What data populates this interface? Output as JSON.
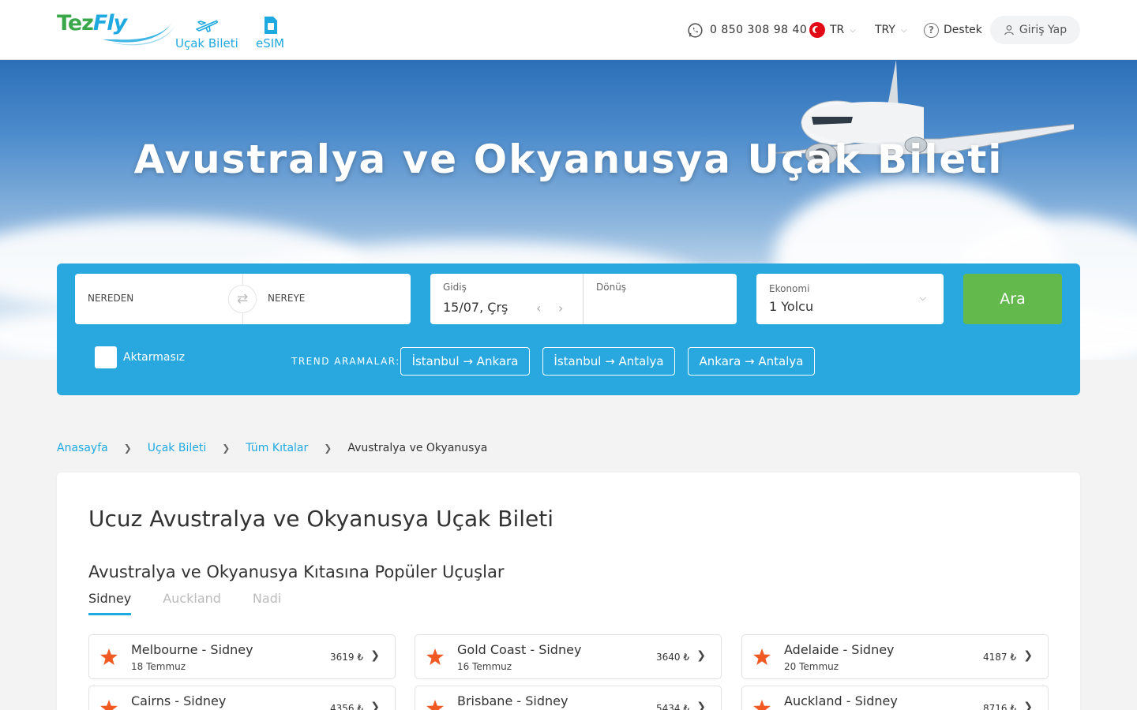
{
  "header": {
    "logo": {
      "part1": "Tez",
      "part2": "Fly"
    },
    "nav": [
      {
        "label": "Uçak Bileti",
        "icon": "plane-icon"
      },
      {
        "label": "eSIM",
        "icon": "sim-card-icon"
      }
    ],
    "phone": "0 850 308 98 40",
    "language": "TR",
    "currency": "TRY",
    "support": "Destek",
    "login": "Giriş Yap"
  },
  "hero": {
    "title": "Avustralya ve Okyanusya Uçak Bileti"
  },
  "search": {
    "from_label": "NEREDEN",
    "to_label": "NEREYE",
    "depart_label": "Gidiş",
    "depart_value": "15/07, Çrş",
    "return_label": "Dönüş",
    "return_value": "",
    "cabin_label": "Ekonomi",
    "passengers_value": "1 Yolcu",
    "search_button": "Ara",
    "direct_label": "Aktarmasız",
    "trend_label": "TREND ARAMALAR:",
    "trends": [
      "İstanbul → Ankara",
      "İstanbul → Antalya",
      "Ankara → Antalya"
    ]
  },
  "breadcrumb": {
    "items": [
      "Anasayfa",
      "Uçak Bileti",
      "Tüm Kıtalar"
    ],
    "current": "Avustralya ve Okyanusya"
  },
  "content": {
    "title": "Ucuz Avustralya ve Okyanusya Uçak Bileti",
    "subtitle": "Avustralya ve Okyanusya Kıtasına Popüler Uçuşlar",
    "tabs": [
      "Sidney",
      "Auckland",
      "Nadi"
    ],
    "active_tab": "Sidney",
    "flights": [
      {
        "route": "Melbourne - Sidney",
        "date": "18 Temmuz",
        "price": "3619 ₺"
      },
      {
        "route": "Gold Coast - Sidney",
        "date": "16 Temmuz",
        "price": "3640 ₺"
      },
      {
        "route": "Adelaide - Sidney",
        "date": "20 Temmuz",
        "price": "4187 ₺"
      },
      {
        "route": "Cairns - Sidney",
        "date": "",
        "price": "4356 ₺"
      },
      {
        "route": "Brisbane - Sidney",
        "date": "",
        "price": "5434 ₺"
      },
      {
        "route": "Auckland - Sidney",
        "date": "",
        "price": "8716 ₺"
      }
    ]
  },
  "colors": {
    "brand_blue": "#29a8e0",
    "link_blue": "#1fa9e1",
    "brand_green": "#3aa84a",
    "search_button": "#64b94c",
    "star": "#f05a22"
  }
}
